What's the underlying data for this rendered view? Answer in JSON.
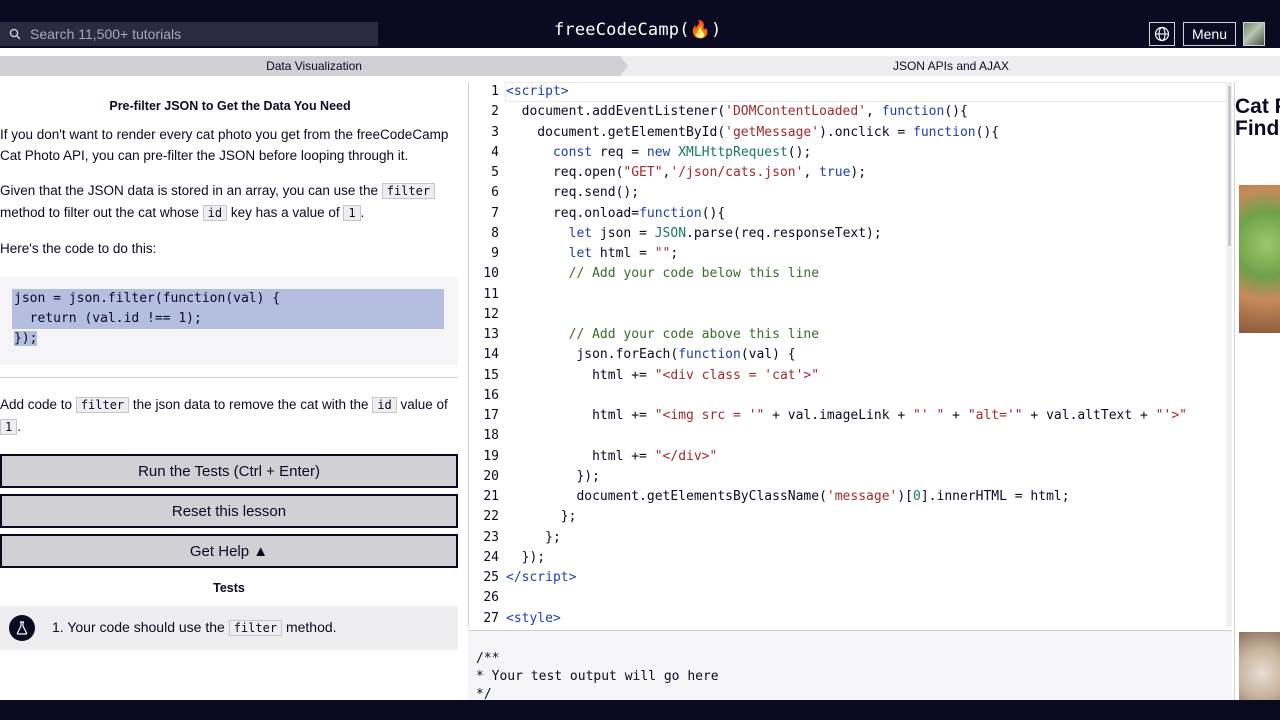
{
  "nav": {
    "search_placeholder": "Search 11,500+ tutorials",
    "brand": "freeCodeCamp(🔥)",
    "menu_label": "Menu"
  },
  "tabs": {
    "left": "Data Visualization",
    "right": "JSON APIs and AJAX"
  },
  "lesson": {
    "title": "Pre-filter JSON to Get the Data You Need",
    "p1": "If you don't want to render every cat photo you get from the freeCodeCamp Cat Photo API, you can pre-filter the JSON before looping through it.",
    "p2_a": "Given that the JSON data is stored in an array, you can use the ",
    "p2_code1": "filter",
    "p2_b": " method to filter out the cat whose ",
    "p2_code2": "id",
    "p2_c": " key has a value of ",
    "p2_code3": "1",
    "p2_d": ".",
    "p3": "Here's the code to do this:",
    "code_lines": [
      "json = json.filter(function(val) {",
      "  return (val.id !== 1);",
      "});"
    ],
    "p4_a": "Add code to ",
    "p4_code1": "filter",
    "p4_b": " the json data to remove the cat with the ",
    "p4_code2": "id",
    "p4_c": " value of ",
    "p4_code3": "1",
    "p4_d": "."
  },
  "buttons": {
    "run": "Run the Tests (Ctrl + Enter)",
    "reset": "Reset this lesson",
    "help": "Get Help ▲"
  },
  "tests": {
    "label": "Tests",
    "items": [
      {
        "pre": "1. Your code should use the ",
        "code": "filter",
        "post": " method."
      }
    ]
  },
  "editor": {
    "lines": [
      {
        "n": "1",
        "html": "<span class=\"k\">&lt;script&gt;</span>"
      },
      {
        "n": "2",
        "html": "  document.addEventListener(<span class=\"s\">'DOMContentLoaded'</span>, <span class=\"k\">function</span>(){"
      },
      {
        "n": "3",
        "html": "    document.getElementById(<span class=\"s\">'getMessage'</span>).onclick = <span class=\"k\">function</span>(){"
      },
      {
        "n": "4",
        "html": "      <span class=\"k\">const</span> req = <span class=\"k\">new</span> <span class=\"g\">XMLHttpRequest</span>();"
      },
      {
        "n": "5",
        "html": "      req.open(<span class=\"s\">\"GET\"</span>,<span class=\"s\">'/json/cats.json'</span>, <span class=\"k\">true</span>);"
      },
      {
        "n": "6",
        "html": "      req.send();"
      },
      {
        "n": "7",
        "html": "      req.onload=<span class=\"k\">function</span>(){"
      },
      {
        "n": "8",
        "html": "        <span class=\"k\">let</span> json = <span class=\"g\">JSON</span>.parse(req.responseText);"
      },
      {
        "n": "9",
        "html": "        <span class=\"k\">let</span> html = <span class=\"s\">\"\"</span>;"
      },
      {
        "n": "10",
        "html": "        <span class=\"c\">// Add your code below this line</span>"
      },
      {
        "n": "11",
        "html": ""
      },
      {
        "n": "12",
        "html": ""
      },
      {
        "n": "13",
        "html": "        <span class=\"c\">// Add your code above this line</span>"
      },
      {
        "n": "14",
        "html": "         json.forEach(<span class=\"k\">function</span>(val) {"
      },
      {
        "n": "15",
        "html": "           html += <span class=\"s\">\"&lt;div class = 'cat'&gt;\"</span>"
      },
      {
        "n": "16",
        "html": ""
      },
      {
        "n": "17",
        "html": "           html += <span class=\"s\">\"&lt;img src = '\"</span> + val.imageLink + <span class=\"s\">\"' \"</span> + <span class=\"s\">\"alt='\"</span> + val.altText + <span class=\"s\">\"'&gt;\"</span>"
      },
      {
        "n": "18",
        "html": ""
      },
      {
        "n": "19",
        "html": "           html += <span class=\"s\">\"&lt;/div&gt;\"</span>"
      },
      {
        "n": "20",
        "html": "         });"
      },
      {
        "n": "21",
        "html": "         document.getElementsByClassName(<span class=\"s\">'message'</span>)[<span class=\"g\">0</span>].innerHTML = html;"
      },
      {
        "n": "22",
        "html": "       };"
      },
      {
        "n": "23",
        "html": "     };"
      },
      {
        "n": "24",
        "html": "  });"
      },
      {
        "n": "25",
        "html": "<span class=\"k\">&lt;/script&gt;</span>"
      },
      {
        "n": "26",
        "html": ""
      },
      {
        "n": "27",
        "html": "<span class=\"k\">&lt;style&gt;</span>"
      }
    ]
  },
  "output": {
    "text": "/**\n* Your test output will go here\n*/"
  },
  "preview": {
    "title": "Cat Photo Finder"
  }
}
